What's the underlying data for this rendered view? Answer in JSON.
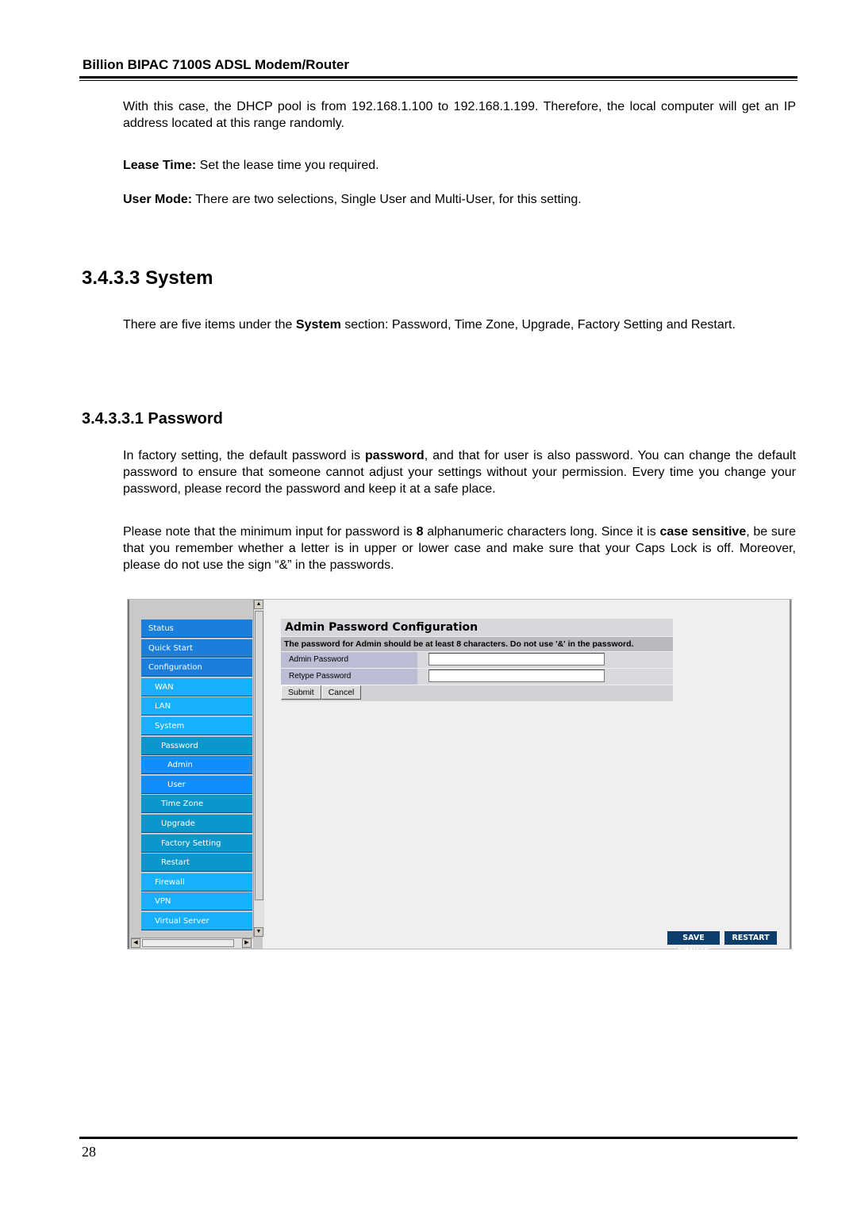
{
  "header": {
    "title": "Billion BIPAC 7100S ADSL Modem/Router"
  },
  "intro": {
    "dhcp_text": "With this case, the DHCP pool is from 192.168.1.100 to 192.168.1.199. Therefore, the local computer will get an IP address located at this range randomly.",
    "lease_label": "Lease Time:",
    "lease_text": " Set the lease time you required.",
    "usermode_label": "User Mode:",
    "usermode_text": " There are two selections, Single User and Multi-User, for this setting."
  },
  "system_section": {
    "heading": "3.4.3.3 System",
    "text_pre": "There are five items under the ",
    "text_bold": "System",
    "text_post": " section: Password, Time Zone, Upgrade, Factory Setting and Restart."
  },
  "password_section": {
    "heading": "3.4.3.3.1 Password",
    "p1_pre": "In factory setting, the default password is ",
    "p1_bold": "password",
    "p1_post": ", and that for user is also password. You can change the default password to ensure that someone cannot adjust your settings without your permission. Every time you change your password, please record the password and keep it at a safe place.",
    "p2_pre": "Please note that the minimum input for password is ",
    "p2_bold1": "8",
    "p2_mid": " alphanumeric characters long. Since it is ",
    "p2_bold2": "case sensitive",
    "p2_post": ", be sure that you remember whether a letter is in upper or lower case and make sure that your Caps Lock is off. Moreover, please do not use the sign “&” in the passwords."
  },
  "screenshot": {
    "nav_items": [
      {
        "label": "Status",
        "level": 0
      },
      {
        "label": "Quick Start",
        "level": 0
      },
      {
        "label": "Configuration",
        "level": 0
      },
      {
        "label": "WAN",
        "level": 1
      },
      {
        "label": "LAN",
        "level": 1
      },
      {
        "label": "System",
        "level": 1
      },
      {
        "label": "Password",
        "level": 2
      },
      {
        "label": "Admin",
        "level": 3,
        "focused": true
      },
      {
        "label": "User",
        "level": 3
      },
      {
        "label": "Time Zone",
        "level": 2
      },
      {
        "label": "Upgrade",
        "level": 2
      },
      {
        "label": "Factory Setting",
        "level": 2
      },
      {
        "label": "Restart",
        "level": 2
      },
      {
        "label": "Firewall",
        "level": 1
      },
      {
        "label": "VPN",
        "level": 1
      },
      {
        "label": "Virtual Server",
        "level": 1
      }
    ],
    "panel_title": "Admin Password Configuration",
    "panel_note": "The password for Admin should be at least 8 characters. Do not use '&' in the password.",
    "fields": [
      {
        "label": "Admin Password",
        "value": ""
      },
      {
        "label": "Retype Password",
        "value": ""
      }
    ],
    "submit_label": "Submit",
    "cancel_label": "Cancel",
    "save_config_label": "SAVE CONFIG",
    "restart_label": "RESTART"
  },
  "footer": {
    "page_number": "28"
  }
}
